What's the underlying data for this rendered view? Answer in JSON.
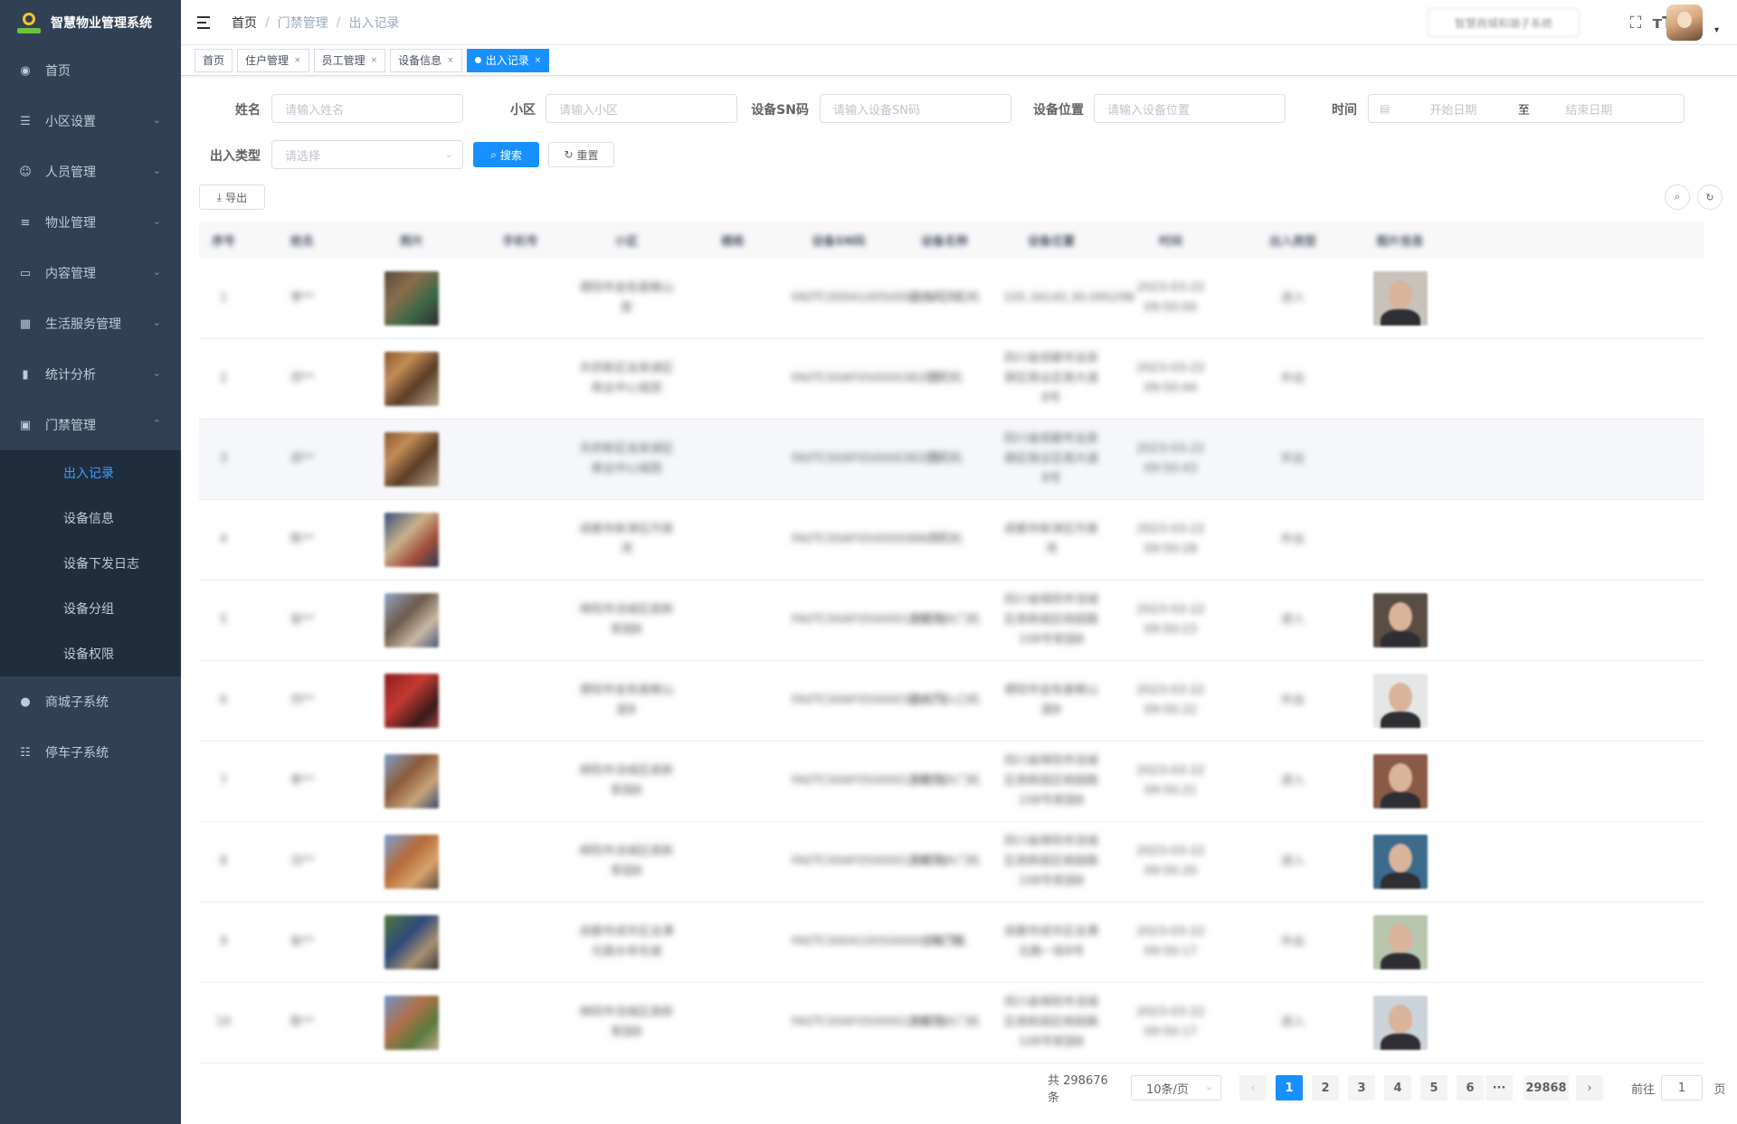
{
  "app": {
    "logo_text": "智慧物业管理系统"
  },
  "sidebar": {
    "items": [
      {
        "label": "首页",
        "icon": "dashboard-icon",
        "glyph": "◉",
        "arrow": ""
      },
      {
        "label": "小区设置",
        "icon": "list-icon",
        "glyph": "☰",
        "arrow": "⌄"
      },
      {
        "label": "人员管理",
        "icon": "people-icon",
        "glyph": "☺",
        "arrow": "⌄"
      },
      {
        "label": "物业管理",
        "icon": "sliders-icon",
        "glyph": "≡",
        "arrow": "⌄"
      },
      {
        "label": "内容管理",
        "icon": "monitor-icon",
        "glyph": "▭",
        "arrow": "⌄"
      },
      {
        "label": "生活服务管理",
        "icon": "grid-icon",
        "glyph": "▦",
        "arrow": "⌄"
      },
      {
        "label": "统计分析",
        "icon": "bar-chart-icon",
        "glyph": "▮",
        "arrow": "⌄"
      },
      {
        "label": "门禁管理",
        "icon": "lock-icon",
        "glyph": "▣",
        "arrow": "⌃"
      }
    ],
    "sub_items": [
      "出入记录",
      "设备信息",
      "设备下发日志",
      "设备分组",
      "设备权限"
    ],
    "items_after": [
      {
        "label": "商城子系统",
        "icon": "globe-icon",
        "glyph": "●",
        "arrow": ""
      },
      {
        "label": "停车子系统",
        "icon": "list-detail-icon",
        "glyph": "☷",
        "arrow": ""
      }
    ]
  },
  "header": {
    "breadcrumb": [
      "首页",
      "门禁管理",
      "出入记录"
    ],
    "breadcrumb_separator": "/",
    "system_button": "智慧商城和端子系统",
    "fullscreen_glyph": "⛶",
    "font_size_glyph": "ᴛT",
    "avatar_caret": "▾"
  },
  "tags": [
    {
      "label": "首页",
      "close": ""
    },
    {
      "label": "住户管理",
      "close": "×"
    },
    {
      "label": "员工管理",
      "close": "×"
    },
    {
      "label": "设备信息",
      "close": "×"
    },
    {
      "label": "出入记录",
      "close": "×",
      "active": true
    }
  ],
  "search_form": {
    "name_label": "姓名",
    "name_placeholder": "请输入姓名",
    "community_label": "小区",
    "community_placeholder": "请输入小区",
    "sn_label": "设备SN码",
    "sn_placeholder": "请输入设备SN码",
    "location_label": "设备位置",
    "location_placeholder": "请输入设备位置",
    "time_label": "时间",
    "start_placeholder": "开始日期",
    "range_separator": "至",
    "end_placeholder": "结束日期",
    "type_label": "出入类型",
    "type_placeholder": "请选择",
    "search_button": "搜索",
    "reset_button": "重置",
    "export_button": "导出",
    "search_glyph": "⌕",
    "reset_glyph": "↻",
    "export_glyph": "⤓",
    "calendar_glyph": "▤"
  },
  "table": {
    "columns": [
      "序号",
      "姓名",
      "照片",
      "手机号",
      "小区",
      "楼栋",
      "设备SN码",
      "设备名称",
      "设备位置",
      "时间",
      "出入类型",
      "图片信息"
    ],
    "rows": [
      {
        "index": "1",
        "name": "李**",
        "phone": "",
        "community": "德阳市金色香榭山居",
        "building": "",
        "sn": "FA0TC00041005000003ACTK",
        "device": "正大门入口机",
        "location": "105.34145,30.095298",
        "time": "2023-03-22 09:50:00",
        "type": "进入",
        "photo": "s0",
        "face": "f0"
      },
      {
        "index": "2",
        "name": "邓**",
        "phone": "",
        "community": "天府新区龙泉湖区商业中心组团",
        "building": "",
        "sn": "FA0TC00AF050000382CTK",
        "device": "南门机",
        "location": "四川省成都市龙泉驿区商业区南大道8号",
        "time": "2023-03-22 09:50:44",
        "type": "外出",
        "photo": "s1",
        "face": ""
      },
      {
        "index": "3",
        "name": "邓**",
        "phone": "",
        "community": "天府新区龙泉湖区商业中心组团",
        "building": "",
        "sn": "FA0TC00AF050000382CTK",
        "device": "南门机",
        "location": "四川省成都市龙泉驿区商业区南大道8号",
        "time": "2023-03-22 09:50:43",
        "type": "外出",
        "photo": "s1",
        "face": ""
      },
      {
        "index": "4",
        "name": "陈**",
        "phone": "",
        "community": "成都市新津区丹景湾",
        "building": "",
        "sn": "FA0TC00AF050000088CTK",
        "device": "大门机",
        "location": "成都市新津区丹景湾",
        "time": "2023-03-22 09:50:28",
        "type": "外出",
        "photo": "s2",
        "face": ""
      },
      {
        "index": "5",
        "name": "张**",
        "phone": "",
        "community": "绵阳市涪城区高新家园B",
        "building": "",
        "sn": "FA0TC00AF050000129CTK",
        "device": "东侧北大门机",
        "location": "四川省绵阳市涪城区高新园区桃园路108号家园B",
        "time": "2023-03-22 09:50:23",
        "type": "进入",
        "photo": "s3",
        "face": "f3"
      },
      {
        "index": "6",
        "name": "刘**",
        "phone": "",
        "community": "德阳市金色香榭山居B",
        "building": "",
        "sn": "FA0TC00AF050000386CTK",
        "device": "正大门入口机",
        "location": "德阳市金色香榭山居B",
        "time": "2023-03-22 09:50:22",
        "type": "外出",
        "photo": "s4",
        "face": "f1"
      },
      {
        "index": "7",
        "name": "李**",
        "phone": "",
        "community": "绵阳市涪城区高新家园B",
        "building": "",
        "sn": "FA0TC00AF050000129CTK",
        "device": "东侧北大门机",
        "location": "四川省绵阳市涪城区高新园区桃园路108号家园B",
        "time": "2023-03-22 09:50:21",
        "type": "进入",
        "photo": "s5",
        "face": "f4"
      },
      {
        "index": "8",
        "name": "冯**",
        "phone": "",
        "community": "绵阳市涪城区高新家园B",
        "building": "",
        "sn": "FA0TC00AF050000129CTK",
        "device": "东侧北大门机",
        "location": "四川省绵阳市涪城区高新园区桃园路108号家园B",
        "time": "2023-03-22 09:50:20",
        "type": "进入",
        "photo": "s6",
        "face": "f5"
      },
      {
        "index": "9",
        "name": "张**",
        "phone": "",
        "community": "成都市成华区龙潭北路水岸名城",
        "building": "",
        "sn": "FA0TC00041005000003ACTK",
        "device": "2号门机",
        "location": "成都市成华区龙潭北路一街8号",
        "time": "2023-03-22 09:50:17",
        "type": "外出",
        "photo": "s7",
        "face": "f2"
      },
      {
        "index": "10",
        "name": "陈**",
        "phone": "",
        "community": "绵阳市涪城区高新家园B",
        "building": "",
        "sn": "FA0TC00AF050000129CTK",
        "device": "东侧北大门机",
        "location": "四川省绵阳市涪城区高新园区桃园路108号家园B",
        "time": "2023-03-22 09:50:17",
        "type": "进入",
        "photo": "s8",
        "face": "f6"
      }
    ]
  },
  "pagination": {
    "total_text": "共 298676 条",
    "page_size": "10条/页",
    "pages": [
      "1",
      "2",
      "3",
      "4",
      "5",
      "6"
    ],
    "more": "···",
    "last_page": "29868",
    "prev_glyph": "‹",
    "next_glyph": "›",
    "goto_label": "前往",
    "goto_value": "1",
    "page_suffix": "页",
    "select_caret": "⌄",
    "current_page": 1
  }
}
